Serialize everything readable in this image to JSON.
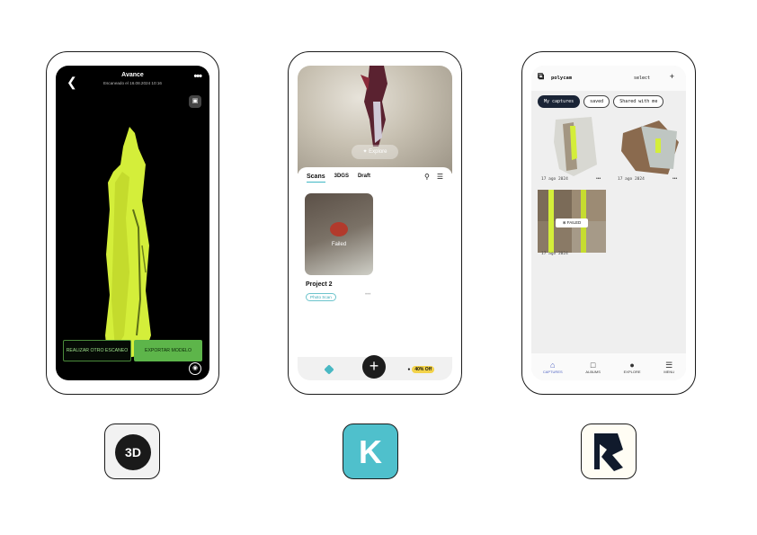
{
  "phone1": {
    "title": "Avance",
    "subtitle": "Escaneado el 16.08.2024 10:16",
    "btn_again": "REALIZAR OTRO ESCANEO",
    "btn_export": "EXPORTAR MODELO"
  },
  "phone2": {
    "explore": "Explore",
    "tabs": [
      "Scans",
      "3DGS",
      "Draft"
    ],
    "card_status": "Failed",
    "project_title": "Project 2",
    "badge": "Photo Scan",
    "more": "•••",
    "offer": "40% Off"
  },
  "phone3": {
    "brand": "polycam",
    "select": "select",
    "chips": [
      "My captures",
      "saved",
      "Shared with me"
    ],
    "captures": [
      {
        "date": "17 ago 2024",
        "status": ""
      },
      {
        "date": "17 ago 2024",
        "status": ""
      },
      {
        "date": "17 ago 2024",
        "status": "FAILED"
      }
    ],
    "nav": [
      {
        "label": "CAPTURES",
        "icon": "home-icon"
      },
      {
        "label": "ALBUMS",
        "icon": "folder-icon"
      },
      {
        "label": "EXPLORE",
        "icon": "globe-icon"
      },
      {
        "label": "MENU",
        "icon": "menu-icon"
      }
    ]
  },
  "apps": {
    "app1_label": "3D"
  },
  "colors": {
    "scan_green": "#d4ee3a",
    "export_green": "#5db54a",
    "kiri_teal": "#4fc0cc",
    "polycam_navy": "#1a2436"
  }
}
